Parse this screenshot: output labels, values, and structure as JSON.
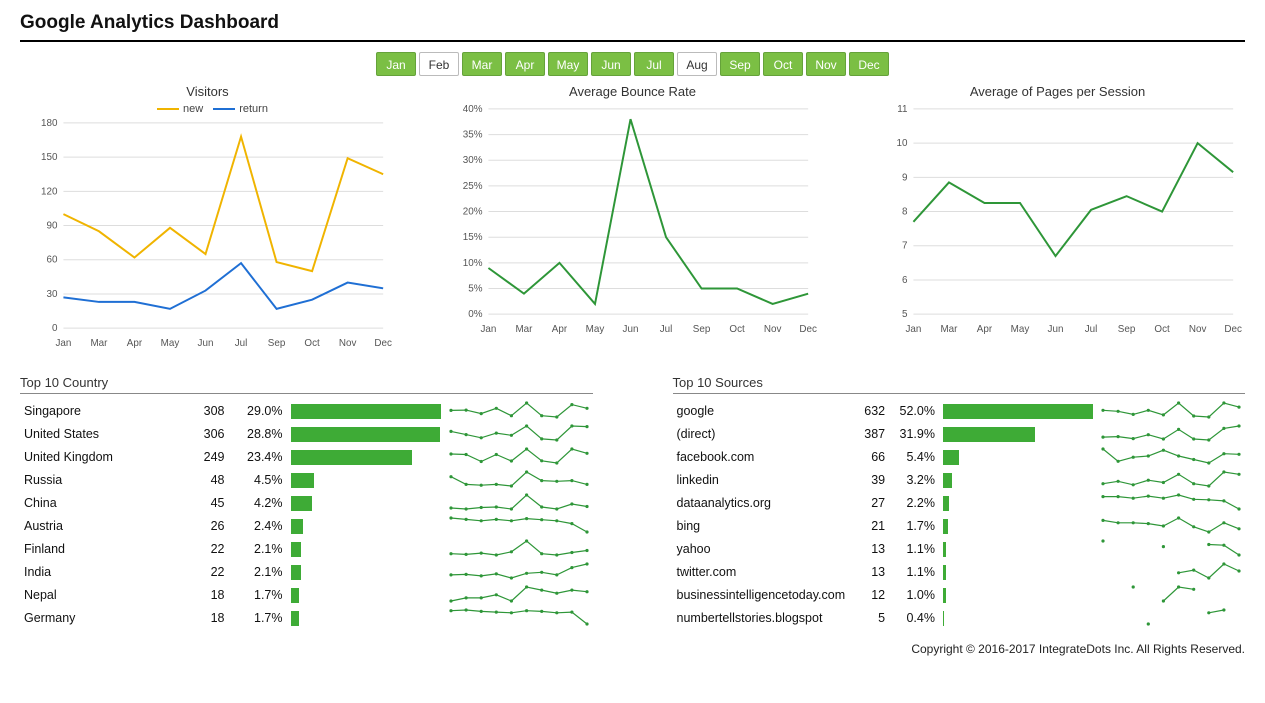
{
  "page": {
    "title": "Google Analytics Dashboard",
    "footer": "Copyright © 2016-2017 IntegrateDots Inc. All Rights Reserved."
  },
  "months": [
    {
      "label": "Jan",
      "active": true
    },
    {
      "label": "Feb",
      "active": false
    },
    {
      "label": "Mar",
      "active": true
    },
    {
      "label": "Apr",
      "active": true
    },
    {
      "label": "May",
      "active": true
    },
    {
      "label": "Jun",
      "active": true
    },
    {
      "label": "Jul",
      "active": true
    },
    {
      "label": "Aug",
      "active": false
    },
    {
      "label": "Sep",
      "active": true
    },
    {
      "label": "Oct",
      "active": true
    },
    {
      "label": "Nov",
      "active": true
    },
    {
      "label": "Dec",
      "active": true
    }
  ],
  "chart_data": [
    {
      "type": "line",
      "title": "Visitors",
      "categories": [
        "Jan",
        "Mar",
        "Apr",
        "May",
        "Jun",
        "Jul",
        "Sep",
        "Oct",
        "Nov",
        "Dec"
      ],
      "series": [
        {
          "name": "new",
          "color": "#f0b400",
          "values": [
            100,
            85,
            62,
            88,
            65,
            168,
            58,
            50,
            149,
            135
          ]
        },
        {
          "name": "return",
          "color": "#1f6fd4",
          "values": [
            27,
            23,
            23,
            17,
            33,
            57,
            17,
            25,
            40,
            35
          ]
        }
      ],
      "ylim": [
        0,
        180
      ],
      "ystep": 30,
      "ylabel": "",
      "xlabel": ""
    },
    {
      "type": "line",
      "title": "Average Bounce Rate",
      "categories": [
        "Jan",
        "Mar",
        "Apr",
        "May",
        "Jun",
        "Jul",
        "Sep",
        "Oct",
        "Nov",
        "Dec"
      ],
      "series": [
        {
          "name": "rate",
          "color": "#2e9638",
          "values": [
            9,
            4,
            10,
            2,
            38,
            15,
            5,
            5,
            2,
            4
          ]
        }
      ],
      "ylim": [
        0,
        40
      ],
      "ystep": 5,
      "ysuffix": "%",
      "ylabel": "",
      "xlabel": ""
    },
    {
      "type": "line",
      "title": "Average of Pages per Session",
      "categories": [
        "Jan",
        "Mar",
        "Apr",
        "May",
        "Jun",
        "Jul",
        "Sep",
        "Oct",
        "Nov",
        "Dec"
      ],
      "series": [
        {
          "name": "pages",
          "color": "#2e9638",
          "values": [
            7.7,
            8.85,
            8.25,
            8.25,
            6.7,
            8.05,
            8.45,
            8.0,
            10.0,
            9.15
          ]
        }
      ],
      "ylim": [
        5,
        11
      ],
      "ystep": 1,
      "ylabel": "",
      "xlabel": ""
    }
  ],
  "tables": [
    {
      "title": "Top 10 Country",
      "max_pct": 29.0,
      "rows": [
        {
          "label": "Singapore",
          "count": 308,
          "pct": "29.0%",
          "pctv": 29.0,
          "spark": [
            60,
            61,
            48,
            68,
            40,
            88,
            40,
            35,
            82,
            68
          ]
        },
        {
          "label": "United States",
          "count": 306,
          "pct": "28.8%",
          "pctv": 28.8,
          "spark": [
            70,
            55,
            40,
            62,
            52,
            95,
            35,
            30,
            95,
            92
          ]
        },
        {
          "label": "United Kingdom",
          "count": 249,
          "pct": "23.4%",
          "pctv": 23.4,
          "spark": [
            72,
            70,
            42,
            70,
            44,
            92,
            45,
            36,
            92,
            75
          ]
        },
        {
          "label": "Russia",
          "count": 48,
          "pct": "4.5%",
          "pctv": 4.5,
          "spark": [
            50,
            30,
            28,
            30,
            26,
            62,
            40,
            38,
            40,
            30
          ]
        },
        {
          "label": "China",
          "count": 45,
          "pct": "4.2%",
          "pctv": 4.2,
          "spark": [
            32,
            30,
            33,
            34,
            30,
            58,
            34,
            30,
            40,
            35
          ]
        },
        {
          "label": "Austria",
          "count": 26,
          "pct": "2.4%",
          "pctv": 2.4,
          "spark": [
            60,
            55,
            50,
            55,
            50,
            58,
            54,
            50,
            40,
            10
          ]
        },
        {
          "label": "Finland",
          "count": 22,
          "pct": "2.1%",
          "pctv": 2.1,
          "spark": [
            40,
            38,
            42,
            36,
            46,
            80,
            40,
            36,
            44,
            50
          ]
        },
        {
          "label": "India",
          "count": 22,
          "pct": "2.1%",
          "pctv": 2.1,
          "spark": [
            34,
            36,
            30,
            38,
            22,
            40,
            44,
            34,
            62,
            76
          ]
        },
        {
          "label": "Nepal",
          "count": 18,
          "pct": "1.7%",
          "pctv": 1.7,
          "spark": [
            30,
            34,
            34,
            38,
            30,
            48,
            44,
            40,
            44,
            42
          ]
        },
        {
          "label": "Germany",
          "count": 18,
          "pct": "1.7%",
          "pctv": 1.7,
          "spark": [
            50,
            52,
            48,
            46,
            44,
            50,
            48,
            44,
            46,
            12
          ]
        }
      ]
    },
    {
      "title": "Top 10 Sources",
      "max_pct": 52.0,
      "rows": [
        {
          "label": "google",
          "count": 632,
          "pct": "52.0%",
          "pctv": 52.0,
          "spark": [
            60,
            56,
            44,
            60,
            42,
            88,
            38,
            34,
            88,
            72
          ]
        },
        {
          "label": "(direct)",
          "count": 387,
          "pct": "31.9%",
          "pctv": 31.9,
          "spark": [
            48,
            50,
            42,
            58,
            40,
            80,
            40,
            36,
            84,
            94
          ]
        },
        {
          "label": "facebook.com",
          "count": 66,
          "pct": "5.4%",
          "pctv": 5.4,
          "spark": [
            72,
            30,
            44,
            48,
            68,
            48,
            36,
            24,
            56,
            54
          ]
        },
        {
          "label": "linkedin",
          "count": 39,
          "pct": "3.2%",
          "pctv": 3.2,
          "spark": [
            44,
            48,
            42,
            50,
            46,
            60,
            44,
            40,
            64,
            60
          ]
        },
        {
          "label": "dataanalytics.org",
          "count": 27,
          "pct": "2.2%",
          "pctv": 2.2,
          "spark": [
            56,
            56,
            50,
            58,
            50,
            62,
            46,
            44,
            40,
            10
          ]
        },
        {
          "label": "bing",
          "count": 21,
          "pct": "1.7%",
          "pctv": 1.7,
          "spark": [
            72,
            60,
            60,
            56,
            44,
            84,
            40,
            14,
            60,
            30
          ]
        },
        {
          "label": "yahoo",
          "count": 13,
          "pct": "1.1%",
          "pctv": 1.1,
          "spark": [
            60,
            null,
            null,
            null,
            44,
            null,
            null,
            50,
            48,
            20
          ]
        },
        {
          "label": "twitter.com",
          "count": 13,
          "pct": "1.1%",
          "pctv": 1.1,
          "spark": [
            null,
            null,
            null,
            null,
            null,
            52,
            58,
            40,
            72,
            56
          ]
        },
        {
          "label": "businessintelligencetoday.com",
          "count": 12,
          "pct": "1.0%",
          "pctv": 1.0,
          "spark": [
            null,
            null,
            42,
            null,
            30,
            42,
            40,
            null,
            null,
            null
          ]
        },
        {
          "label": "numbertellstories.blogspot",
          "count": 5,
          "pct": "0.4%",
          "pctv": 0.4,
          "spark": [
            null,
            null,
            null,
            40,
            null,
            null,
            null,
            56,
            60,
            null
          ]
        }
      ]
    }
  ]
}
